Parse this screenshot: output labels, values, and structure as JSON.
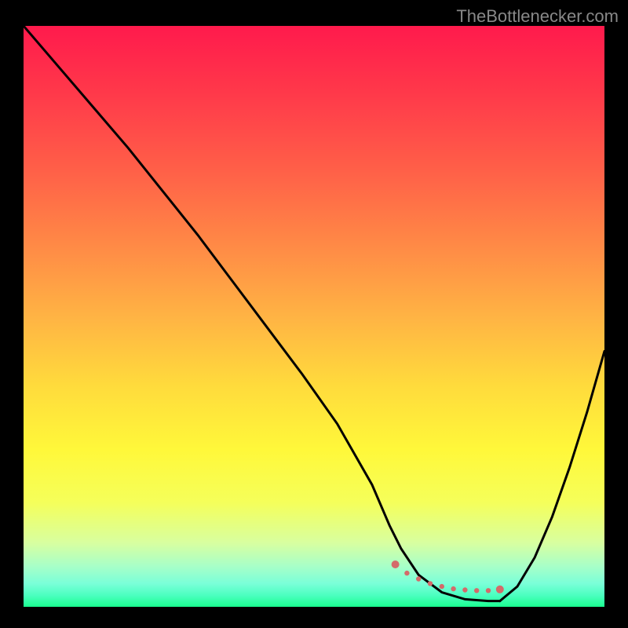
{
  "attribution": "TheBottlenecker.com",
  "chart_data": {
    "type": "line",
    "title": "",
    "xlabel": "",
    "ylabel": "",
    "x_range": [
      0,
      100
    ],
    "y_range": [
      0,
      100
    ],
    "description": "Bottleneck valley plot: color gradient red (top/high bottleneck) to green (bottom/low bottleneck). Two black curves descend from edges into a flat valley near x≈64-82 (the sweet spot marked by dotted segment).",
    "series": [
      {
        "name": "left-curve",
        "x": [
          0,
          6,
          12,
          18,
          24,
          30,
          36,
          42,
          48,
          54,
          60,
          63,
          65,
          68,
          72,
          76,
          80,
          82
        ],
        "y": [
          100,
          93,
          86,
          79,
          71.5,
          64,
          56,
          48,
          40,
          31.5,
          21,
          14,
          10,
          5.5,
          2.5,
          1.3,
          1.0,
          1.0
        ]
      },
      {
        "name": "right-curve",
        "x": [
          82,
          85,
          88,
          91,
          94,
          97,
          100
        ],
        "y": [
          1.0,
          3.5,
          8.5,
          15.5,
          24,
          33.5,
          44
        ]
      },
      {
        "name": "sweet-spot-dots",
        "x": [
          64,
          66,
          68,
          70,
          72,
          74,
          76,
          78,
          80,
          82
        ],
        "y": [
          7.3,
          5.8,
          4.8,
          4.0,
          3.5,
          3.1,
          2.9,
          2.8,
          2.8,
          3.0
        ]
      }
    ],
    "gradient_stops": [
      {
        "pos": 0,
        "color": "#ff1a4c"
      },
      {
        "pos": 12,
        "color": "#ff3a4a"
      },
      {
        "pos": 25,
        "color": "#ff6048"
      },
      {
        "pos": 37,
        "color": "#ff8746"
      },
      {
        "pos": 50,
        "color": "#ffb344"
      },
      {
        "pos": 62,
        "color": "#ffdb3c"
      },
      {
        "pos": 73,
        "color": "#fff83a"
      },
      {
        "pos": 82,
        "color": "#f5ff5a"
      },
      {
        "pos": 89,
        "color": "#d8ffa0"
      },
      {
        "pos": 93,
        "color": "#a8ffc8"
      },
      {
        "pos": 96,
        "color": "#7affd8"
      },
      {
        "pos": 98,
        "color": "#4cffc0"
      },
      {
        "pos": 100,
        "color": "#1aff90"
      }
    ]
  }
}
